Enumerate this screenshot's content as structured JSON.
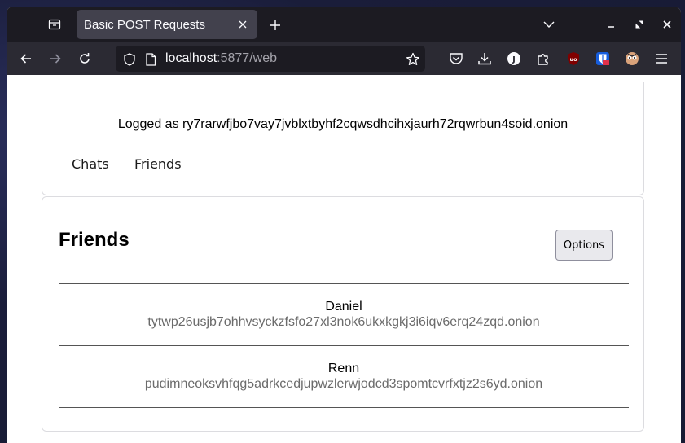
{
  "browser": {
    "tab_title": "Basic POST Requests",
    "url_host": "localhost",
    "url_rest": ":5877/web"
  },
  "page": {
    "logged_prefix": "Logged as ",
    "logged_user": "ry7rarwfjbo7vay7jvblxtbyhf2cqwsdhcihxjaurh72rqwrbun4soid.onion",
    "nav": [
      "Chats",
      "Friends"
    ],
    "section_title": "Friends",
    "options_label": "Options",
    "friends": [
      {
        "name": "Daniel",
        "address": "tytwp26usjb7ohhvsyckzfsfo27xl3nok6ukxkgkj3i6iqv6erq24zqd.onion"
      },
      {
        "name": "Renn",
        "address": "pudimneoksvhfqg5adrkcedjupwzlerwjodcd3spomtcvrfxtjz2s6yd.onion"
      }
    ]
  }
}
